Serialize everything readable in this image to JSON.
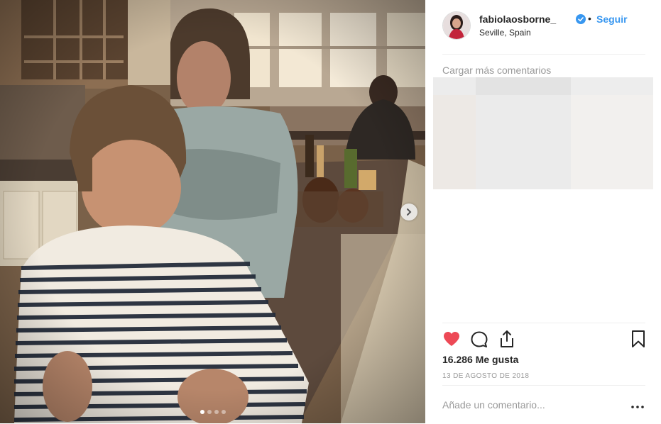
{
  "post": {
    "photo_alt": "Two blurred-face boys seated at a kitchen counter",
    "carousel": {
      "total": 4,
      "active_index": 1
    },
    "next_icon": "chevron-right-icon"
  },
  "header": {
    "username": "fabiolaosborne_",
    "verified_icon": "verified-badge-icon",
    "separator": "•",
    "follow_label": "Seguir",
    "location": "Seville, Spain"
  },
  "comments": {
    "load_more_label": "Cargar más comentarios"
  },
  "actions": {
    "like_icon": "heart-filled-icon",
    "comment_icon": "comment-bubble-icon",
    "share_icon": "share-icon",
    "save_icon": "bookmark-icon",
    "likes_text": "16.286 Me gusta",
    "date_text": "13 DE AGOSTO DE 2018"
  },
  "comment_form": {
    "placeholder": "Añade un comentario...",
    "more_icon": "more-options-icon"
  },
  "colors": {
    "link_blue": "#3897f0",
    "like_red": "#ed4956",
    "text_muted": "#999999",
    "divider": "#efefef"
  }
}
